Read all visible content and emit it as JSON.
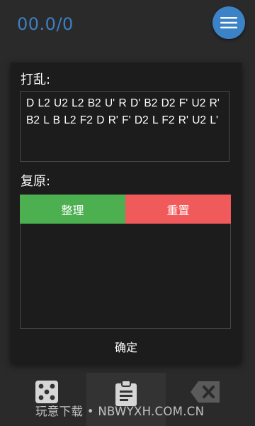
{
  "header": {
    "score": "00.0/0"
  },
  "dialog": {
    "scramble_label": "打乱:",
    "scramble_lines": [
      "D L2 U2 L2 B2 U' R D' B2 D2 F' U2 R'",
      "B2 L B L2 F2 D R' F' D2 L F2 R' U2 L'"
    ],
    "solve_label": "复原:",
    "tidy_label": "整理",
    "reset_label": "重置",
    "confirm_label": "确定"
  },
  "bottom_bar": {
    "tabs": [
      {
        "icon": "dice-icon"
      },
      {
        "icon": "clipboard-icon"
      },
      {
        "icon": "backspace-icon"
      }
    ]
  },
  "watermark": "玩意下载 • NBWYXH.COM.CN",
  "colors": {
    "accent_blue": "#3b83c6",
    "score_blue": "#3d7fc1",
    "tidy_green": "#4caf50",
    "reset_red": "#f15a5a",
    "background": "#2a2a2a",
    "dialog_bg": "#1c1c1c"
  }
}
